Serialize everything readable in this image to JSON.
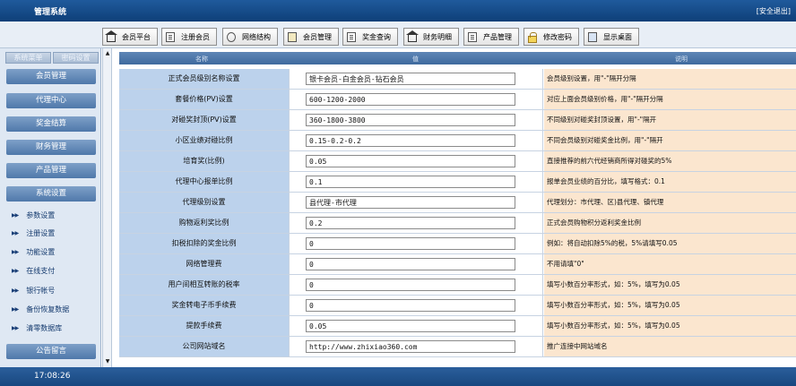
{
  "header": {
    "title": "管理系统",
    "logout": "[安全退出]"
  },
  "toolbar": [
    {
      "label": "会员平台",
      "icon": "house-icon"
    },
    {
      "label": "注册会员",
      "icon": "document-icon"
    },
    {
      "label": "网络结构",
      "icon": "network-icon"
    },
    {
      "label": "会员管理",
      "icon": "book-icon"
    },
    {
      "label": "奖金查询",
      "icon": "document-icon"
    },
    {
      "label": "财务明细",
      "icon": "house-icon"
    },
    {
      "label": "产品管理",
      "icon": "document-icon"
    },
    {
      "label": "修改密码",
      "icon": "lock-icon"
    },
    {
      "label": "显示桌面",
      "icon": "desktop-icon"
    }
  ],
  "sidebar": {
    "tabs": [
      "系统菜单",
      "密码设置"
    ],
    "sections": [
      "会员管理",
      "代理中心",
      "奖金结算",
      "财务管理",
      "产品管理",
      "系统设置"
    ],
    "settings_items": [
      "参数设置",
      "注册设置",
      "功能设置",
      "在线支付",
      "银行帐号",
      "备份恢复数据",
      "清零数据库"
    ],
    "bottom_section": "公告留言"
  },
  "table": {
    "headers": [
      "名称",
      "值",
      "说明"
    ],
    "rows": [
      {
        "label": "正式会员级别名称设置",
        "value": "银卡会员-白金会员-钻石会员",
        "note": "会员级别设置，用\"-\"隔开分隔"
      },
      {
        "label": "套餐价格(PV)设置",
        "value": "600-1200-2000",
        "note": "对应上面会员级别价格，用\"-\"隔开分隔"
      },
      {
        "label": "对碰奖封顶(PV)设置",
        "value": "360-1800-3800",
        "note": "不同级别对碰奖封顶设置，用\"-\"隔开"
      },
      {
        "label": "小区业绩对碰比例",
        "value": "0.15-0.2-0.2",
        "note": "不同会员级别对碰奖金比例，用\"-\"隔开"
      },
      {
        "label": "培育奖(比例)",
        "value": "0.05",
        "note": "直接推荐的前六代经销商所得对碰奖的5%"
      },
      {
        "label": "代理中心报单比例",
        "value": "0.1",
        "note": "报单会员业绩的百分比，填写格式：0.1"
      },
      {
        "label": "代理级别设置",
        "value": "县代理-市代理",
        "note": "代理划分：市代理、区)县代理、镇代理"
      },
      {
        "label": "购物返利奖比例",
        "value": "0.2",
        "note": "正式会员购物积分返利奖金比例"
      },
      {
        "label": "扣税扣除的奖金比例",
        "value": "0",
        "note": "例如：将自动扣除5%的税，5%请填写0.05"
      },
      {
        "label": "网络管理费",
        "value": "0",
        "note": "不用请填\"0\""
      },
      {
        "label": "用户间相互转账的税率",
        "value": "0",
        "note": "填写小数百分率形式，如：5%，填写为0.05"
      },
      {
        "label": "奖金转电子币手续费",
        "value": "0",
        "note": "填写小数百分率形式，如：5%，填写为0.05"
      },
      {
        "label": "提款手续费",
        "value": "0.05",
        "note": "填写小数百分率形式，如：5%，填写为0.05"
      },
      {
        "label": "公司网站域名",
        "value": "http://www.zhixiao360.com",
        "note": "推广连接中网站域名"
      }
    ]
  },
  "footer": {
    "time": "17:08:26"
  }
}
